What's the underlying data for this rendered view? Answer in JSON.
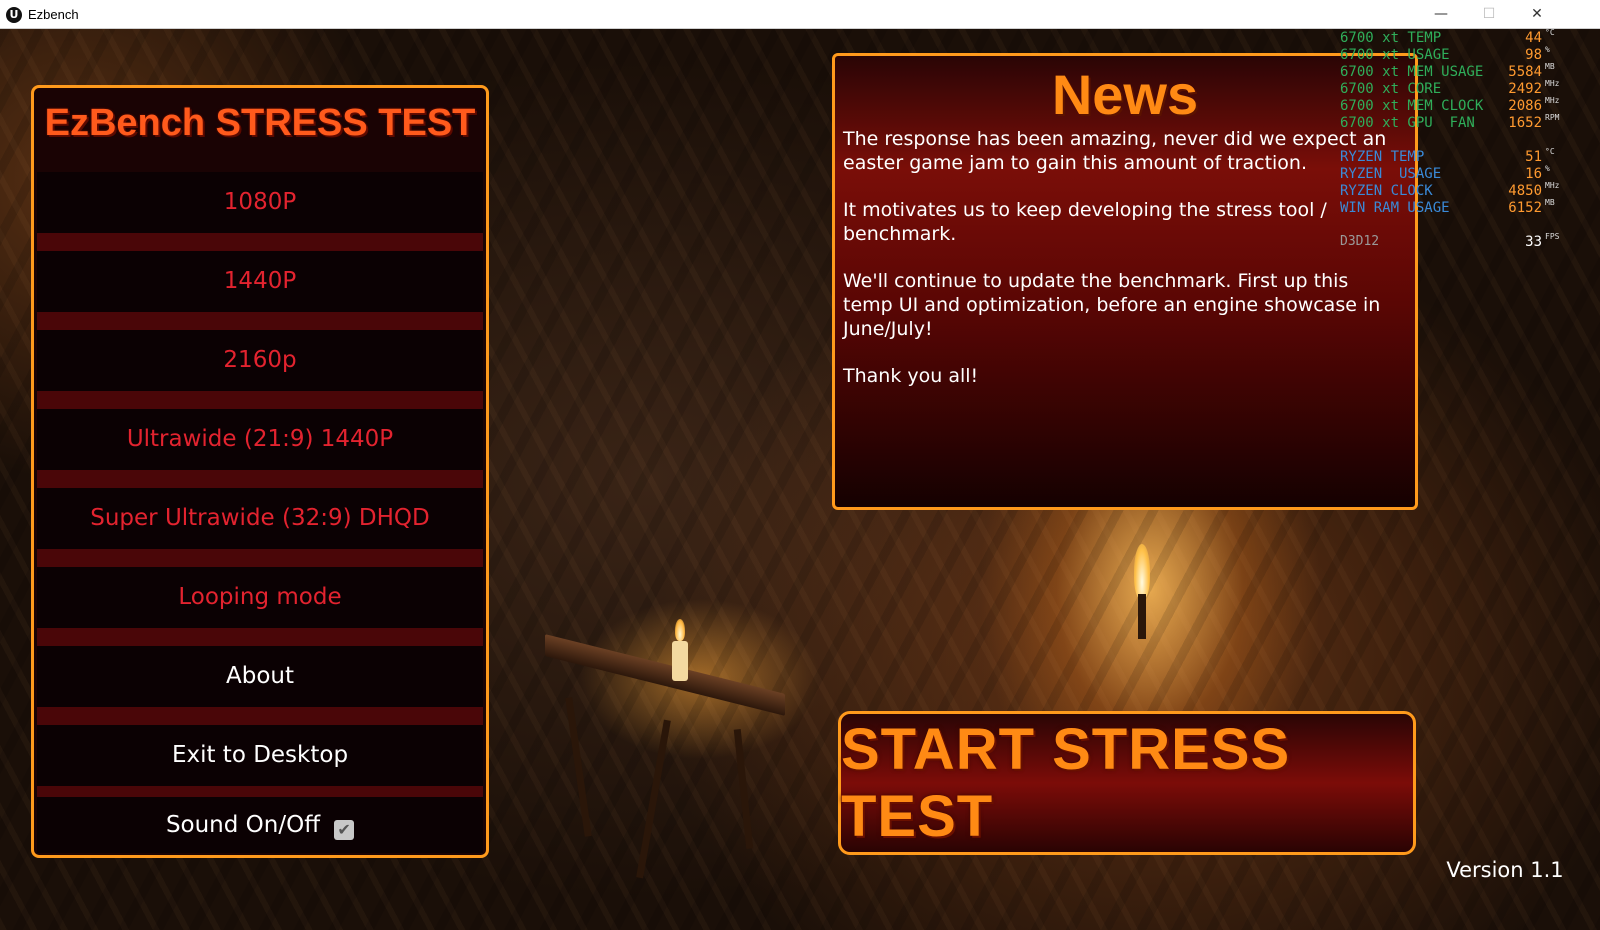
{
  "window": {
    "title": "Ezbench",
    "app_icon": "U",
    "minimize": "—",
    "maximize": "☐",
    "close": "✕"
  },
  "menu": {
    "title": "EzBench STRESS TEST",
    "items": [
      {
        "label": "1080P"
      },
      {
        "label": "1440P"
      },
      {
        "label": "2160p"
      },
      {
        "label": "Ultrawide (21:9) 1440P"
      },
      {
        "label": "Super Ultrawide (32:9) DHQD"
      },
      {
        "label": "Looping mode"
      },
      {
        "label": "About"
      },
      {
        "label": "Exit to Desktop"
      }
    ],
    "sound_label": "Sound On/Off",
    "sound_checked": "✔"
  },
  "news": {
    "title": "News",
    "paragraphs": [
      "The response has been amazing, never did we expect an easter game jam to gain this amount of traction.",
      "It motivates us to keep developing the stress tool / benchmark.",
      "We'll continue to update the benchmark. First up this temp UI and optimization, before an engine showcase in June/July!",
      "Thank you all!"
    ]
  },
  "start_button": {
    "label": "START STRESS TEST"
  },
  "version": "Version 1.1",
  "overlay": {
    "gpu": [
      {
        "label": "6700 xt TEMP",
        "value": "44",
        "unit": "°C"
      },
      {
        "label": "6700 xt USAGE",
        "value": "98",
        "unit": "%"
      },
      {
        "label": "6700 xt MEM USAGE",
        "value": "5584",
        "unit": "MB"
      },
      {
        "label": "6700 xt CORE",
        "value": "2492",
        "unit": "MHz"
      },
      {
        "label": "6700 xt MEM CLOCK",
        "value": "2086",
        "unit": "MHz"
      },
      {
        "label": "6700 xt GPU  FAN",
        "value": "1652",
        "unit": "RPM"
      }
    ],
    "cpu": [
      {
        "label": "RYZEN TEMP",
        "value": "51",
        "unit": "°C"
      },
      {
        "label": "RYZEN  USAGE",
        "value": "16",
        "unit": "%"
      },
      {
        "label": "RYZEN CLOCK",
        "value": "4850",
        "unit": "MHz"
      },
      {
        "label": "WIN RAM USAGE",
        "value": "6152",
        "unit": "MB"
      }
    ],
    "api": "D3D12",
    "fps_value": "33",
    "fps_unit": "FPS"
  }
}
